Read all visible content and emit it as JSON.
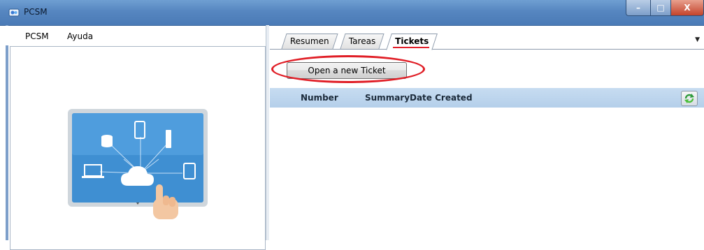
{
  "window": {
    "title": "PCSM",
    "controls": {
      "minimize": "–",
      "maximize": "□",
      "close": "X"
    }
  },
  "menu": {
    "items": [
      {
        "label": "PCSM"
      },
      {
        "label": "Ayuda"
      }
    ]
  },
  "illustration": {
    "icons": [
      "database-icon",
      "phone-icon",
      "usb-icon",
      "laptop-icon",
      "cloud-icon",
      "tablet-icon",
      "hand-pointer-icon"
    ]
  },
  "tabs": [
    {
      "label": "Resumen",
      "active": false
    },
    {
      "label": "Tareas",
      "active": false
    },
    {
      "label": "Tickets",
      "active": true
    }
  ],
  "tickets": {
    "new_button_label": "Open a new Ticket",
    "columns": [
      "Number",
      "Summary",
      "Date Created"
    ],
    "rows": []
  },
  "colors": {
    "highlight": "#e01e26",
    "grid_header": "#c7dcf1",
    "titlebar": "#5686c0"
  }
}
